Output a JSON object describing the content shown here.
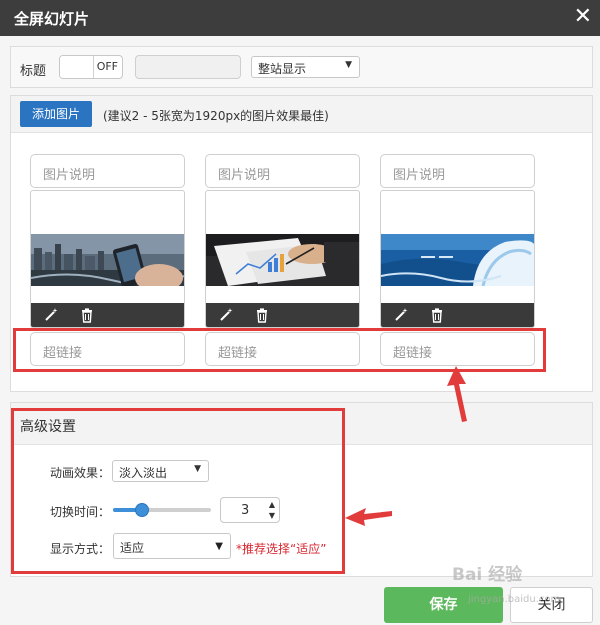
{
  "dialog": {
    "title": "全屏幻灯片",
    "close_symbol": "✕"
  },
  "title_row": {
    "label": "标题",
    "toggle_state": "OFF",
    "title_input_value": "",
    "display_select": "整站显示"
  },
  "images": {
    "add_button": "添加图片",
    "hint": "(建议2 - 5张宽为1920px的图片效果最佳)",
    "caption_placeholder": "图片说明",
    "link_placeholder": "超链接",
    "cards": [
      {
        "scene": "city-phone"
      },
      {
        "scene": "documents-chart"
      },
      {
        "scene": "ocean-wave"
      }
    ]
  },
  "advanced": {
    "title": "高级设置",
    "animation_label": "动画效果：",
    "animation_value": "淡入淡出",
    "interval_label": "切换时间：",
    "interval_value": "3",
    "interval_slider_level": 0.3,
    "display_label": "显示方式：",
    "display_value": "适应",
    "recommend": "*推荐选择“适应”"
  },
  "footer": {
    "save": "保存",
    "close": "关闭"
  },
  "watermark": {
    "brand": "Bai 经验",
    "url": "jingyan.baidu.com"
  },
  "colors": {
    "titlebar": "#3d3d3d",
    "primary": "#2a74c2",
    "save": "#5cb85c",
    "highlight": "#e23b3b",
    "recommend": "#d9262f"
  }
}
